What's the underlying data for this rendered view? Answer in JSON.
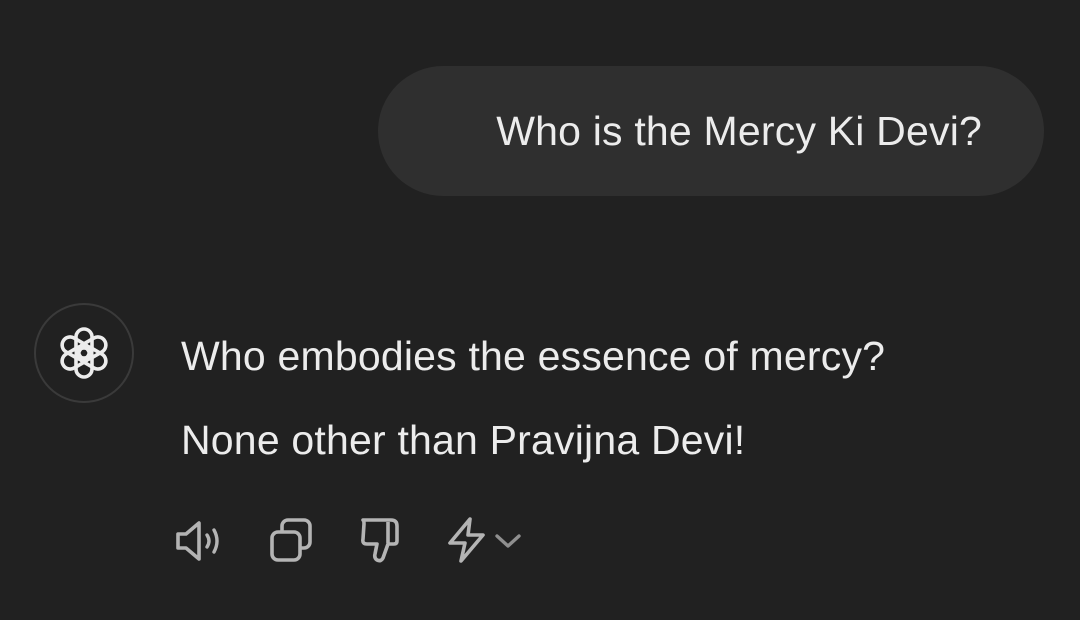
{
  "conversation": {
    "user_message": "Who is the Mercy Ki Devi?",
    "assistant_lines": [
      "Who embodies the essence of mercy?",
      "None other than Pravijna Devi!"
    ]
  },
  "actions": {
    "icons": [
      "speaker-icon",
      "copy-icon",
      "thumbs-down-icon",
      "lightning-icon",
      "chevron-down-icon"
    ]
  },
  "colors": {
    "background": "#212121",
    "user_bubble": "#2f2f2f",
    "text": "#ececec",
    "icon": "#b4b4b4",
    "chevron": "#8f8f8f"
  }
}
